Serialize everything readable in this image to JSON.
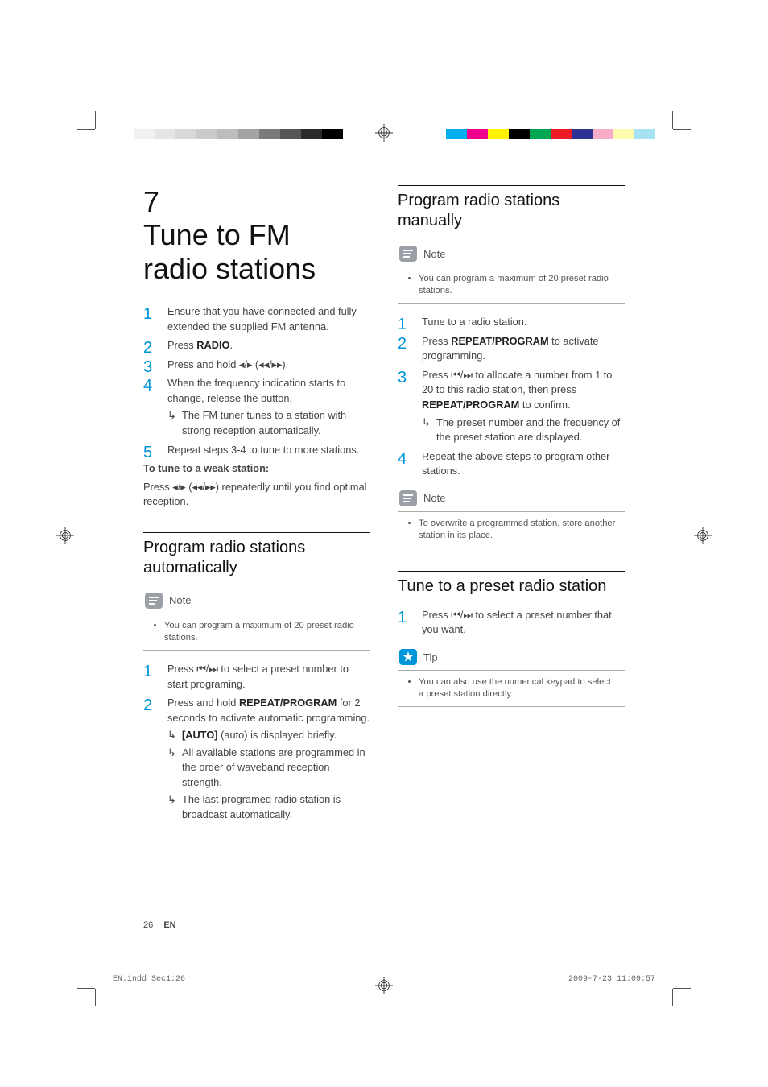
{
  "colorbars_left": [
    "#ffffff",
    "#f1f1f1",
    "#e5e5e5",
    "#d8d8d8",
    "#cbcbcb",
    "#bdbdbd",
    "#a3a3a3",
    "#7b7b7b",
    "#555555",
    "#2b2b2b",
    "#000000"
  ],
  "colorbars_right": [
    "#00adef",
    "#ec008c",
    "#fff200",
    "#000000",
    "#00a651",
    "#ed1c24",
    "#2e3192",
    "#f7adc7",
    "#fffbae",
    "#a6e2f4"
  ],
  "title_num": "7",
  "title_text": "Tune to FM radio stations",
  "left": {
    "steps": [
      "Ensure that you have connected and fully extended the supplied FM antenna.",
      {
        "pre": "Press ",
        "bold": "RADIO",
        "post": "."
      },
      "Press and hold ◂/▸ (◂◂/▸▸).",
      "When the frequency indication starts to change, release the button.",
      "Repeat steps 3-4 to tune to more stations."
    ],
    "step4_result": "The FM tuner tunes to a station with strong reception automatically.",
    "weak_title": "To tune to a weak station:",
    "weak_text": "Press ◂/▸ (◂◂/▸▸) repeatedly until you find optimal reception.",
    "section_auto": "Program radio stations automatically",
    "note_auto_label": "Note",
    "note_auto_text": "You can program a maximum of 20 preset radio stations.",
    "auto_steps": [
      "Press ⏮/⏭ to select a preset number to start programing.",
      {
        "pre": "Press and hold ",
        "bold": "REPEAT/PROGRAM",
        "post": " for 2 seconds to activate automatic programming."
      }
    ],
    "auto_results": [
      {
        "bold": "[AUTO]",
        "post": " (auto) is displayed briefly."
      },
      "All available stations are programmed in the order of waveband reception strength.",
      "The last programed radio station is broadcast automatically."
    ]
  },
  "right": {
    "section_manual": "Program radio stations manually",
    "note_manual_label": "Note",
    "note_manual_text": "You can program a maximum of 20 preset radio stations.",
    "manual_steps": [
      "Tune to a radio station.",
      {
        "pre": "Press ",
        "bold": "REPEAT/PROGRAM",
        "post": " to activate programming."
      },
      {
        "pre": "Press ⏮/⏭ to allocate a number from 1 to 20 to this radio station, then press ",
        "bold": "REPEAT/PROGRAM",
        "post": " to confirm."
      },
      "Repeat the above steps to program other stations."
    ],
    "manual_step3_result": "The preset number and the frequency of the preset station are displayed.",
    "note_overwrite_label": "Note",
    "note_overwrite_text": "To overwrite a programmed station, store another station in its place.",
    "section_preset": "Tune to a preset radio station",
    "preset_step": "Press ⏮/⏭ to select a preset number that you want.",
    "tip_label": "Tip",
    "tip_text": "You can also use the numerical keypad to select a preset station directly."
  },
  "footer": {
    "page": "26",
    "lang": "EN"
  },
  "imprint": {
    "left": "EN.indd   Sec1:26",
    "right": "2009-7-23   11:09:57"
  }
}
